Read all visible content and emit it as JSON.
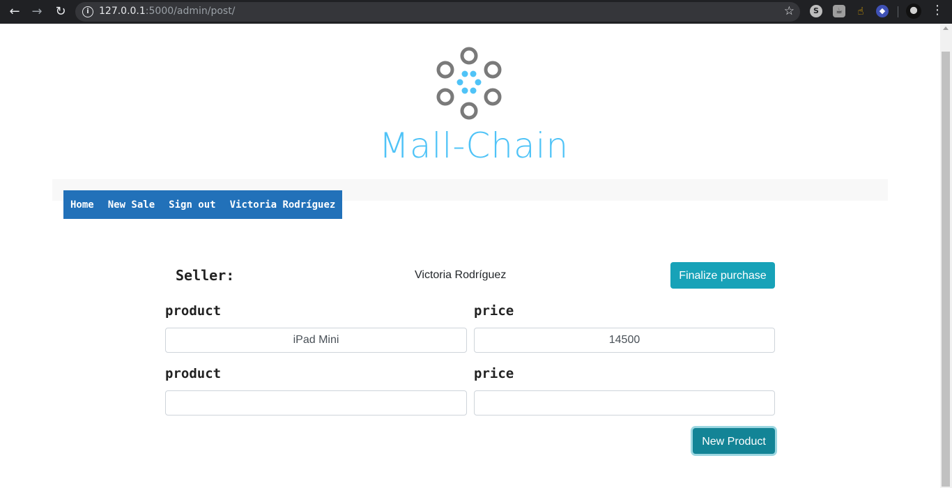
{
  "browser": {
    "url_host": "127.0.0.1",
    "url_rest": ":5000/admin/post/",
    "icons": [
      "back-arrow-icon",
      "forward-arrow-icon",
      "reload-icon",
      "info-icon",
      "star-icon",
      "kebab-menu-icon"
    ]
  },
  "brand": {
    "name": "Mall-Chain",
    "colors": {
      "ring": "#7a7a7a",
      "dot": "#4fc3f7",
      "text": "#4fc3f7"
    }
  },
  "nav": {
    "items": [
      {
        "label": "Home"
      },
      {
        "label": "New Sale"
      },
      {
        "label": "Sign out"
      },
      {
        "label": "Victoria Rodríguez"
      }
    ],
    "bg_color": "#2271b9"
  },
  "seller": {
    "label": "Seller:",
    "name": "Victoria Rodríguez"
  },
  "actions": {
    "finalize_label": "Finalize purchase",
    "new_product_label": "New Product",
    "button_color": "#17a2b8"
  },
  "rows": [
    {
      "product_label": "product",
      "price_label": "price",
      "product_value": "iPad Mini",
      "price_value": "14500"
    },
    {
      "product_label": "product",
      "price_label": "price",
      "product_value": "",
      "price_value": ""
    }
  ]
}
